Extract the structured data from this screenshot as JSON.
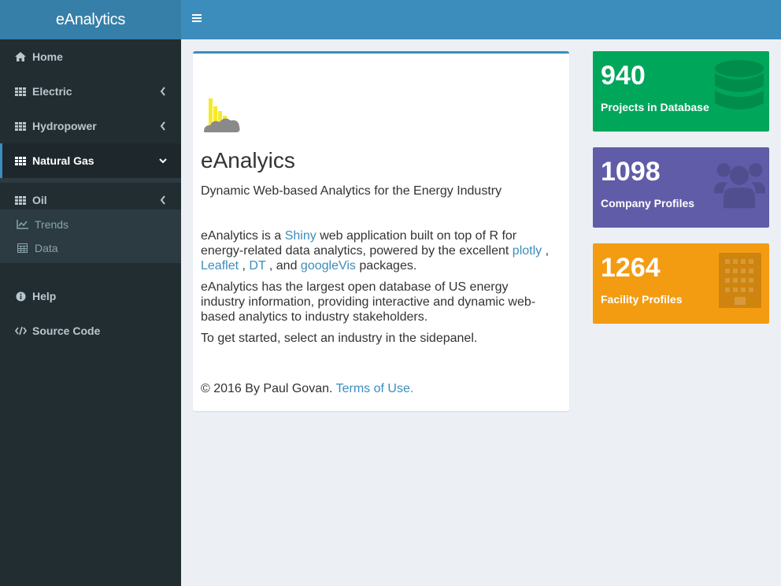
{
  "header": {
    "logo_text": "eAnalytics"
  },
  "sidebar": {
    "items": [
      {
        "label": "Home",
        "icon": "home-icon"
      },
      {
        "label": "Electric",
        "icon": "grid-icon"
      },
      {
        "label": "Hydropower",
        "icon": "grid-icon"
      },
      {
        "label": "Natural Gas",
        "icon": "grid-icon",
        "active": true
      },
      {
        "label": "Oil",
        "icon": "grid-icon"
      },
      {
        "label": "Help",
        "icon": "info-icon"
      },
      {
        "label": "Source Code",
        "icon": "code-icon"
      }
    ],
    "submenu": [
      {
        "label": "Trends",
        "icon": "line-chart-icon"
      },
      {
        "label": "Data",
        "icon": "table-icon"
      }
    ]
  },
  "main": {
    "title": "eAnalyics",
    "subtitle": "Dynamic Web-based Analytics for the Energy Industry",
    "p1": {
      "t1": "eAnalytics is a ",
      "shiny": "Shiny",
      "t2": " web application built on top of R for energy-related data analytics, powered by the excellent ",
      "plotly": "plotly",
      "t3": " , ",
      "leaflet": "Leaflet",
      "t4": " , ",
      "dt": "DT",
      "t5": " , and ",
      "googlevis": "googleVis",
      "t6": " packages."
    },
    "p2": "eAnalytics has the largest open database of US energy industry information, providing interactive and dynamic web-based analytics to industry stakeholders.",
    "p3": "To get started, select an industry in the sidepanel.",
    "footer_text": "© 2016 By Paul Govan. ",
    "footer_link": "Terms of Use."
  },
  "value_boxes": [
    {
      "value": "940",
      "label": "Projects in Database",
      "color": "#00a65a",
      "icon": "database-icon"
    },
    {
      "value": "1098",
      "label": "Company Profiles",
      "color": "#605ca8",
      "icon": "users-icon"
    },
    {
      "value": "1264",
      "label": "Facility Profiles",
      "color": "#f39c12",
      "icon": "building-icon"
    }
  ]
}
